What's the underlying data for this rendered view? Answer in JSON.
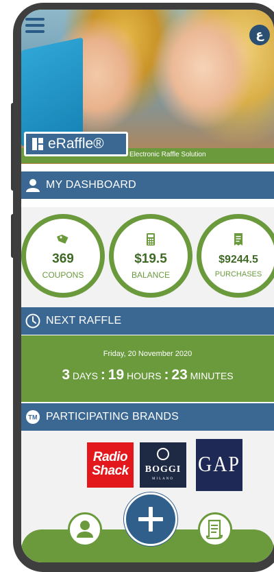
{
  "header": {
    "brand_name": "eRaffle®",
    "tagline": "Electronic Raffle Solution",
    "language_button": "ع"
  },
  "dashboard": {
    "title": "MY DASHBOARD",
    "stats": [
      {
        "value": "369",
        "label": "COUPONS",
        "icon": "tag-icon"
      },
      {
        "value": "$19.5",
        "label": "BALANCE",
        "icon": "calculator-icon"
      },
      {
        "value": "$9244.5",
        "label": "PURCHASES",
        "icon": "receipt-icon"
      }
    ]
  },
  "next_raffle": {
    "title": "NEXT RAFFLE",
    "date": "Friday, 20 November 2020",
    "days": "3",
    "days_label": "DAYS",
    "hours": "19",
    "hours_label": "HOURS",
    "minutes": "23",
    "minutes_label": "MINUTES",
    "separator": ":"
  },
  "brands": {
    "title": "PARTICIPATING BRANDS",
    "items": [
      {
        "name": "Radio Shack",
        "line1": "Radio",
        "line2": "Shack"
      },
      {
        "name": "BOGGI MILANO",
        "line1": "BOGGI",
        "line2": "MILANO"
      },
      {
        "name": "GAP",
        "line1": "GAP"
      }
    ]
  },
  "nav": {
    "items": [
      "profile-icon",
      "plus-icon",
      "scroll-icon"
    ]
  },
  "colors": {
    "primary_blue": "#3a6893",
    "primary_green": "#6b9a3d",
    "dark_green_text": "#3e6a25"
  }
}
